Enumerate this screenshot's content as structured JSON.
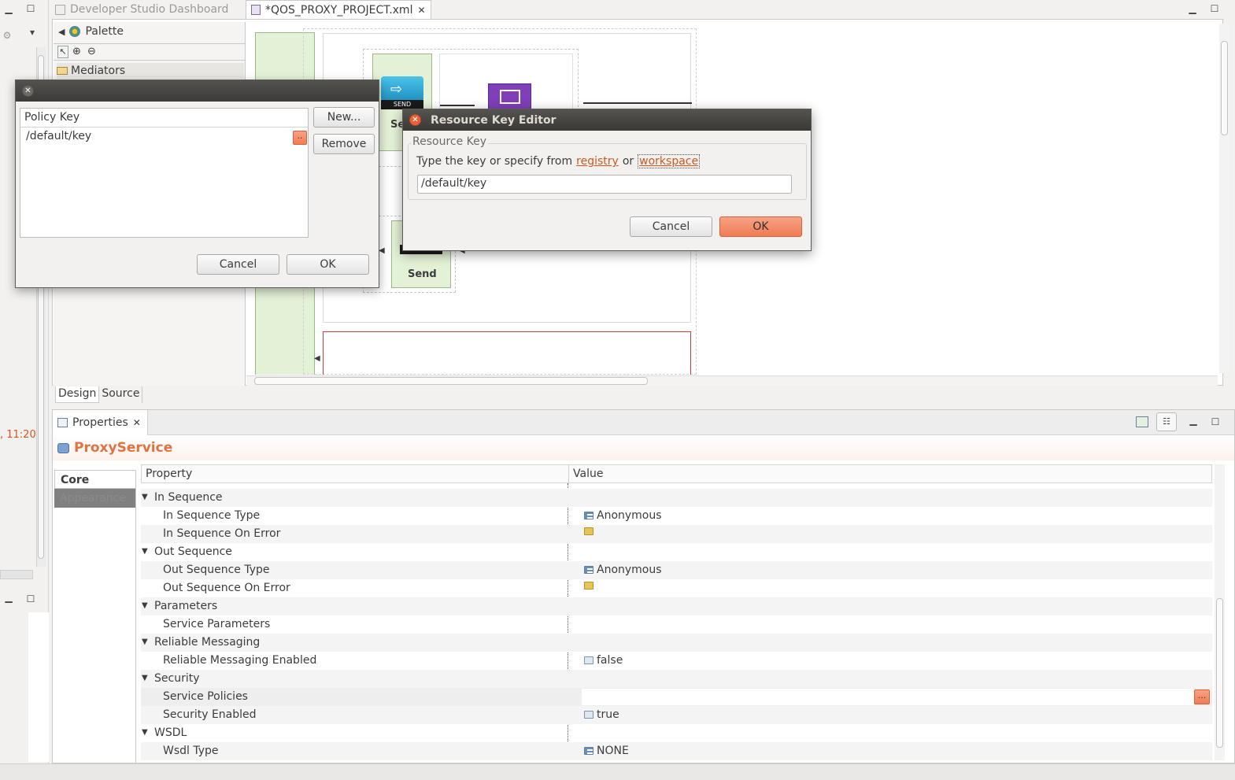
{
  "left_trim": {
    "time_text": ", 11:20"
  },
  "editor": {
    "tabs": [
      {
        "label": "Developer Studio Dashboard",
        "active": false
      },
      {
        "label": "*QOS_PROXY_PROJECT.xml",
        "active": true
      }
    ],
    "palette": {
      "title": "Palette",
      "group": "Mediators"
    },
    "canvas": {
      "send_label_1": "SEND",
      "send_label_2": "SEND",
      "send_title_partial": "Se",
      "send_title": "Send"
    },
    "bottom_tabs": [
      "Design",
      "Source"
    ]
  },
  "policy_dialog": {
    "column_header": "Policy Key",
    "row_value": "/default/key",
    "browse_label": "..",
    "new_label": "New...",
    "remove_label": "Remove",
    "cancel_label": "Cancel",
    "ok_label": "OK"
  },
  "resource_key_editor": {
    "title": "Resource Key Editor",
    "group_label": "Resource Key",
    "instruction_prefix": "Type the key or specify from",
    "registry_link": "registry",
    "or_text": "or",
    "workspace_link": "workspace",
    "key_value": "/default/key",
    "cancel_label": "Cancel",
    "ok_label": "OK"
  },
  "properties": {
    "tab_title": "Properties",
    "object_title": "ProxyService",
    "side_tabs": [
      "Core",
      "Appearance"
    ],
    "col_property": "Property",
    "col_value": "Value",
    "rows": [
      {
        "name": "In Sequence",
        "value": "",
        "group": true,
        "icon": "none"
      },
      {
        "name": "In Sequence Type",
        "value": "Anonymous",
        "group": false,
        "icon": "list-icon"
      },
      {
        "name": "In Sequence On Error",
        "value": "",
        "group": false,
        "icon": "folder-icon"
      },
      {
        "name": "Out Sequence",
        "value": "",
        "group": true,
        "icon": "none"
      },
      {
        "name": "Out Sequence Type",
        "value": "Anonymous",
        "group": false,
        "icon": "list-icon"
      },
      {
        "name": "Out Sequence On Error",
        "value": "",
        "group": false,
        "icon": "folder-icon"
      },
      {
        "name": "Parameters",
        "value": "",
        "group": true,
        "icon": "none"
      },
      {
        "name": "Service Parameters",
        "value": "",
        "group": false,
        "icon": "none"
      },
      {
        "name": "Reliable Messaging",
        "value": "",
        "group": true,
        "icon": "none"
      },
      {
        "name": "Reliable Messaging Enabled",
        "value": "false",
        "group": false,
        "icon": "boolean-icon"
      },
      {
        "name": "Security",
        "value": "",
        "group": true,
        "icon": "none"
      },
      {
        "name": "Service Policies",
        "value": "",
        "group": false,
        "icon": "none"
      },
      {
        "name": "Security Enabled",
        "value": "true",
        "group": false,
        "icon": "boolean-icon"
      },
      {
        "name": "WSDL",
        "value": "",
        "group": true,
        "icon": "none"
      },
      {
        "name": "Wsdl Type",
        "value": "NONE",
        "group": false,
        "icon": "list-icon"
      }
    ],
    "service_policies_button": "..."
  },
  "colors": {
    "accent": "#ef7c55",
    "link": "#d2571c",
    "title_orange": "#e0733f",
    "dialog_title_bg": "#3d3b39"
  }
}
